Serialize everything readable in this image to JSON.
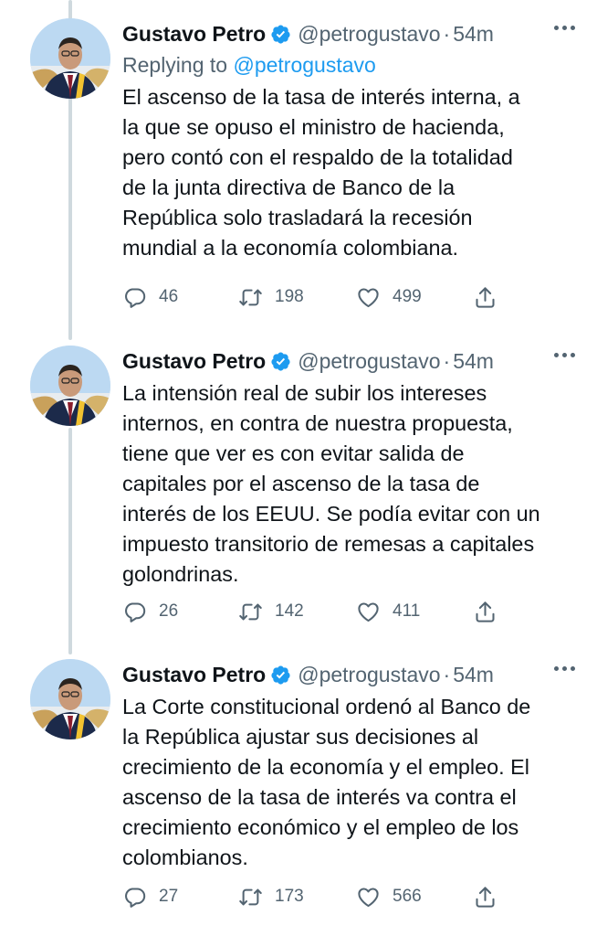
{
  "tweets": [
    {
      "name": "Gustavo Petro",
      "handle": "@petrogustavo",
      "separator": "·",
      "time": "54m",
      "reply_prefix": "Replying to",
      "reply_handle": "@petrogustavo",
      "lines": [
        "El ascenso de la tasa de interés interna, a",
        "la que se opuso el ministro de hacienda,",
        "pero contó con el respaldo de la totalidad",
        "de la junta directiva de Banco de la",
        "República solo trasladará la recesión",
        "mundial a la economía colombiana."
      ],
      "replies": "46",
      "retweets": "198",
      "likes": "499"
    },
    {
      "name": "Gustavo Petro",
      "handle": "@petrogustavo",
      "separator": "·",
      "time": "54m",
      "lines": [
        "La intensión real de subir los intereses",
        "internos, en contra de nuestra propuesta,",
        "tiene que ver es con evitar salida de",
        "capitales por el ascenso de la tasa de",
        "interés de los EEUU. Se podía evitar con un",
        "impuesto transitorio de remesas a capitales",
        "golondrinas."
      ],
      "replies": "26",
      "retweets": "142",
      "likes": "411"
    },
    {
      "name": "Gustavo Petro",
      "handle": "@petrogustavo",
      "separator": "·",
      "time": "54m",
      "lines": [
        "La Corte constitucional ordenó al Banco de",
        "la República ajustar sus decisiones al",
        "crecimiento de la economía y el empleo. El",
        "ascenso de la tasa de interés va contra el",
        "crecimiento económico y el empleo de los",
        "colombianos."
      ],
      "replies": "27",
      "retweets": "173",
      "likes": "566"
    }
  ],
  "icons": {
    "verified": "verified-badge-icon",
    "more": "more-options-icon",
    "reply": "reply-icon",
    "retweet": "retweet-icon",
    "like": "like-icon",
    "share": "share-icon"
  },
  "colors": {
    "link": "#1d9bf0",
    "secondary_text": "#536471",
    "primary_text": "#0f1419",
    "thread_line": "#cfd9de"
  }
}
